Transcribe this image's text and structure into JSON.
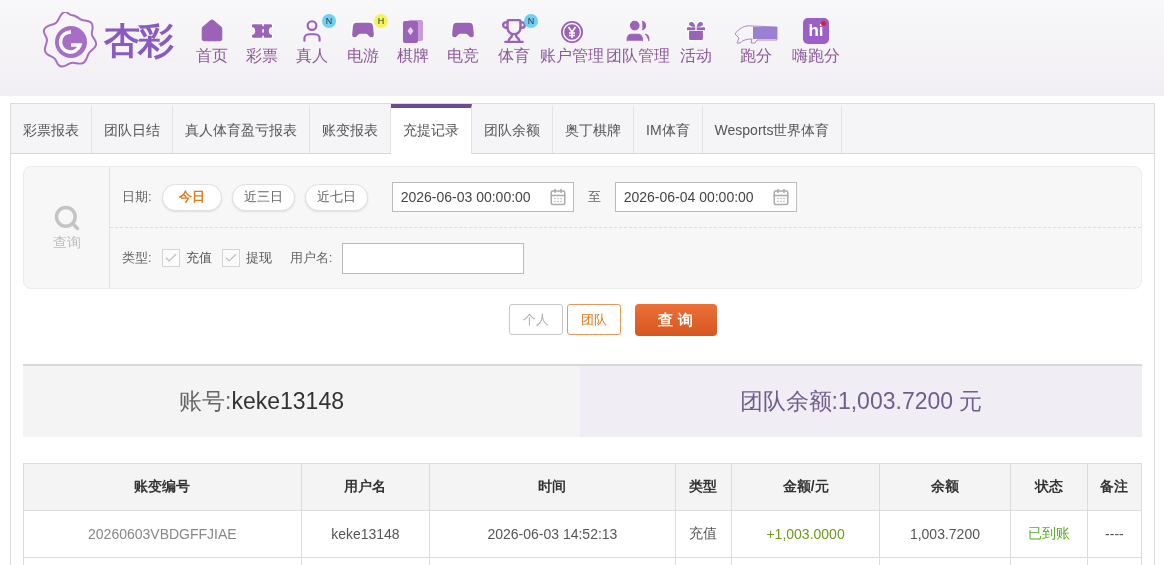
{
  "logo": {
    "text": "杏彩"
  },
  "nav": [
    {
      "label": "首页",
      "kind": "home"
    },
    {
      "label": "彩票",
      "kind": "ticket"
    },
    {
      "label": "真人",
      "kind": "person",
      "badge": "N"
    },
    {
      "label": "电游",
      "kind": "gamepad",
      "badge": "H"
    },
    {
      "label": "棋牌",
      "kind": "cards"
    },
    {
      "label": "电竞",
      "kind": "gamepad"
    },
    {
      "label": "体育",
      "kind": "trophy",
      "badge": "N"
    },
    {
      "label": "账户管理",
      "kind": "yen"
    },
    {
      "label": "团队管理",
      "kind": "users"
    },
    {
      "label": "活动",
      "kind": "gift"
    },
    {
      "label": "跑分",
      "kind": "rhino"
    },
    {
      "label": "嗨跑分",
      "kind": "hi",
      "icon_text": "hi"
    }
  ],
  "tabs": [
    {
      "label": "彩票报表",
      "selected": false
    },
    {
      "label": "团队日结",
      "selected": false
    },
    {
      "label": "真人体育盈亏报表",
      "selected": false
    },
    {
      "label": "账变报表",
      "selected": false
    },
    {
      "label": "充提记录",
      "selected": true
    },
    {
      "label": "团队余额",
      "selected": false
    },
    {
      "label": "奥丁棋牌",
      "selected": false
    },
    {
      "label": "IM体育",
      "selected": false
    },
    {
      "label": "Wesports世界体育",
      "selected": false
    }
  ],
  "filter": {
    "side_label": "查询",
    "date_label": "日期:",
    "quick_ranges": [
      {
        "label": "今日",
        "selected": true
      },
      {
        "label": "近三日",
        "selected": false
      },
      {
        "label": "近七日",
        "selected": false
      }
    ],
    "date_from": "2026-06-03 00:00:00",
    "range_separator": "至",
    "date_to": "2026-06-04 00:00:00",
    "type_label": "类型:",
    "types": [
      {
        "label": "充值",
        "checked": true
      },
      {
        "label": "提现",
        "checked": true
      }
    ],
    "username_label": "用户名:"
  },
  "scope_buttons": [
    {
      "label": "个人",
      "selected": false
    },
    {
      "label": "团队",
      "selected": true
    }
  ],
  "query_button": "查 询",
  "summary": {
    "account_label": "账号:",
    "account": "keke13148",
    "balance": "团队余额:1,003.7200 元"
  },
  "table": {
    "columns": [
      "账变编号",
      "用户名",
      "时间",
      "类型",
      "金额/元",
      "余额",
      "状态",
      "备注"
    ],
    "rows": [
      {
        "id": "20260603VBDGFFJIAE",
        "user": "keke13148",
        "time": "2026-06-03 14:52:13",
        "type": "充值",
        "amount": "+1,003.0000",
        "balance": "1,003.7200",
        "status": "已到账",
        "note": "----"
      }
    ]
  }
}
